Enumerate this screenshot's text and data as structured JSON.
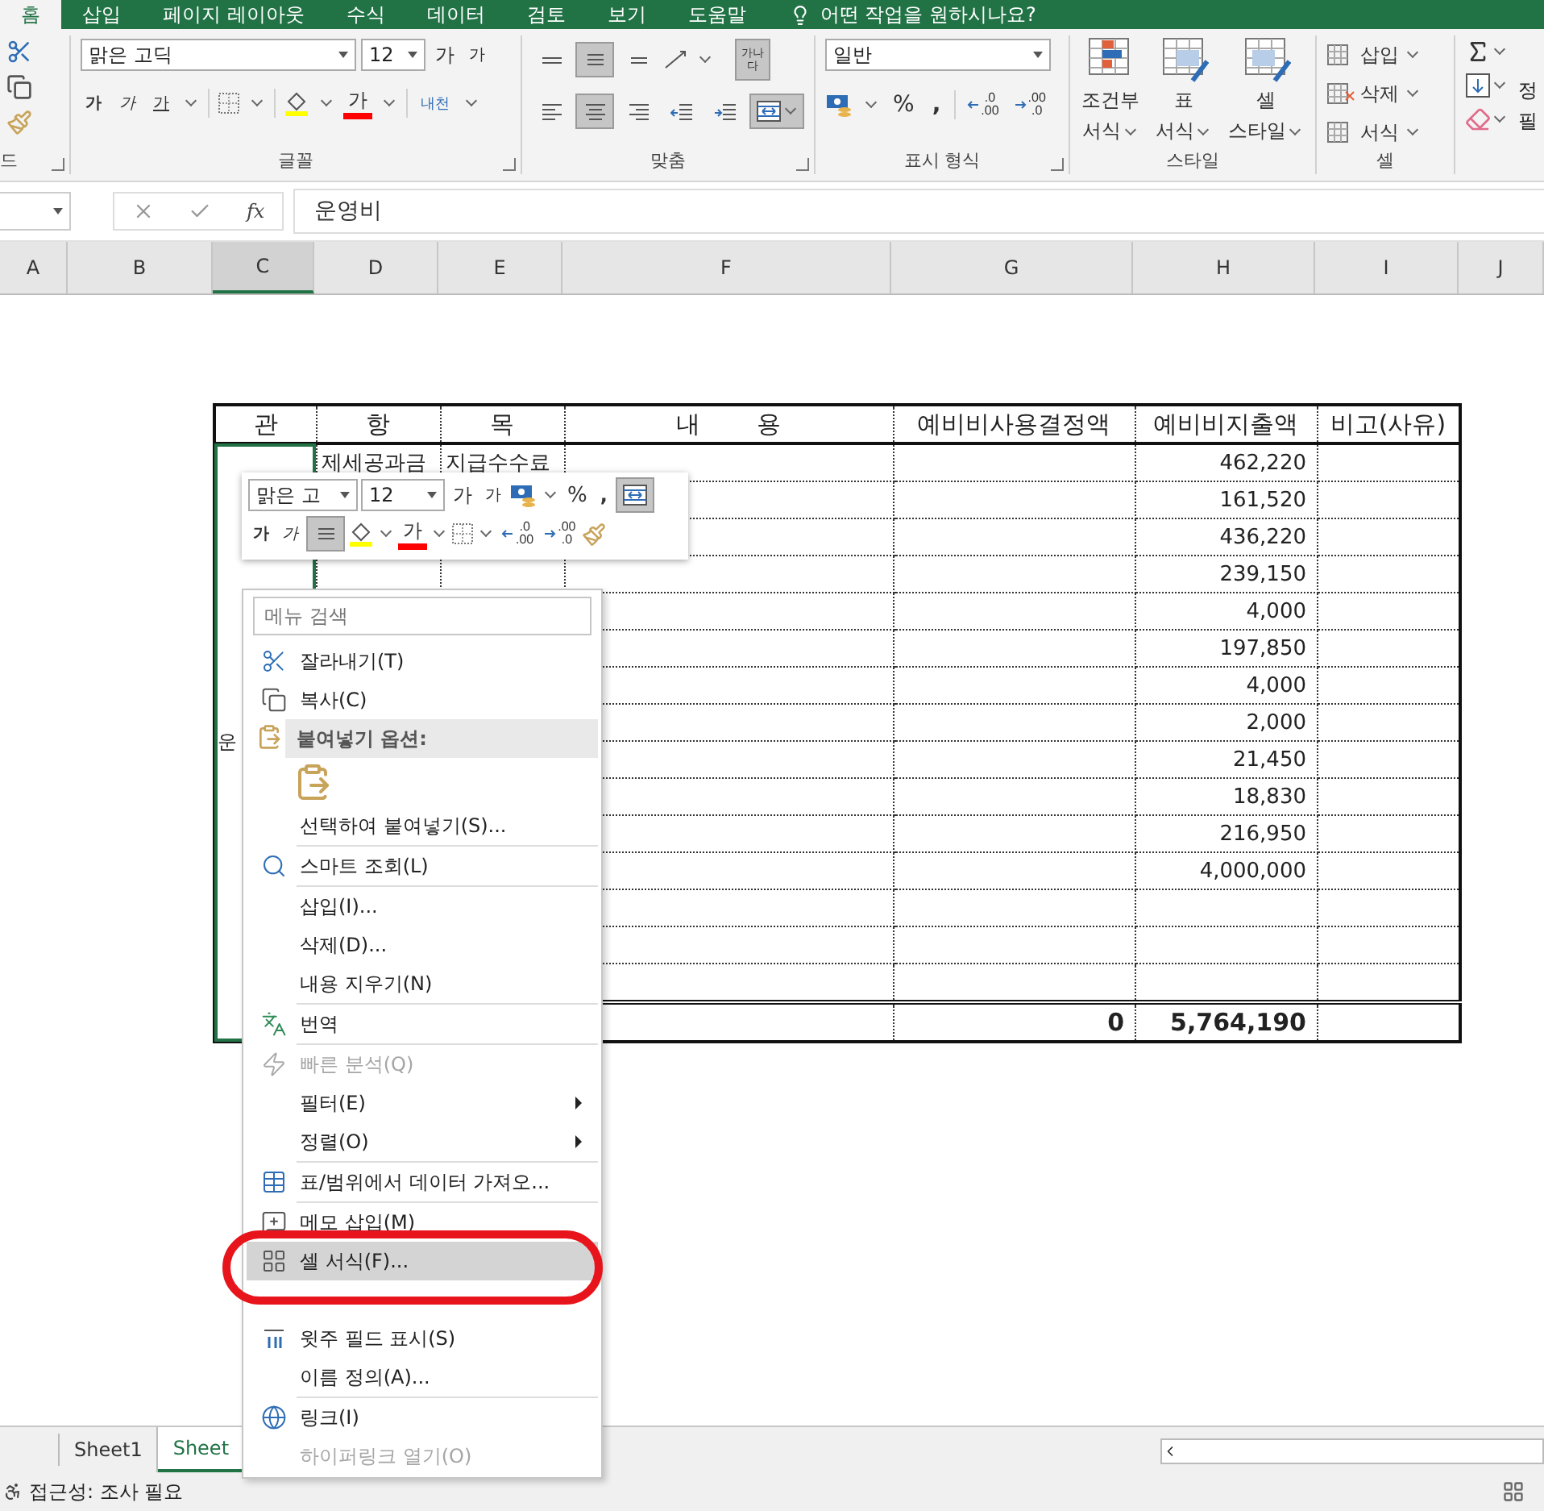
{
  "tabs": [
    {
      "label": "홈",
      "selected": true
    },
    {
      "label": "삽입",
      "selected": false
    },
    {
      "label": "페이지 레이아웃",
      "selected": false
    },
    {
      "label": "수식",
      "selected": false
    },
    {
      "label": "데이터",
      "selected": false
    },
    {
      "label": "검토",
      "selected": false
    },
    {
      "label": "보기",
      "selected": false
    },
    {
      "label": "도움말",
      "selected": false
    }
  ],
  "tell_me": "어떤 작업을 원하시나요?",
  "ribbon": {
    "clipboard_label": "드",
    "font": {
      "name": "맑은 고딕",
      "size": "12",
      "grow": "가",
      "shrink": "가",
      "bold": "가",
      "italic": "가",
      "underline": "가",
      "color_glyph": "가",
      "phonetic": "내천",
      "label": "글꼴"
    },
    "alignment": {
      "top_row": [
        {
          "kind": "top",
          "selected": false
        },
        {
          "kind": "middle",
          "selected": true
        },
        {
          "kind": "bottom",
          "selected": false
        }
      ],
      "bottom_row": [
        {
          "kind": "left",
          "selected": false
        },
        {
          "kind": "center",
          "selected": true
        },
        {
          "kind": "right",
          "selected": false
        },
        {
          "kind": "outdent",
          "selected": false
        },
        {
          "kind": "indent",
          "selected": false
        }
      ],
      "wrap": {
        "glyph": "가나다",
        "selected": true
      },
      "merge_selected": true,
      "label": "맞춤"
    },
    "number": {
      "format": "일반",
      "percent": "%",
      "comma": ",",
      "decimals": [
        {
          "top": ".0",
          "bottom": ".00"
        },
        {
          "top": ".00",
          "bottom": ".0"
        }
      ],
      "label": "표시 형식"
    },
    "styles": {
      "buttons": [
        {
          "line1": "조건부",
          "line2": "서식"
        },
        {
          "line1": "표",
          "line2": "서식"
        },
        {
          "line1": "셀",
          "line2": "스타일"
        }
      ],
      "label": "스타일"
    },
    "cells": {
      "buttons": [
        "삽입",
        "삭제",
        "서식"
      ],
      "label": "셀"
    },
    "editing": {
      "parts": [
        "정",
        "필"
      ]
    }
  },
  "formula_bar": {
    "function_label": "fx",
    "value": "운영비"
  },
  "columns": [
    {
      "letter": "A",
      "selected": false
    },
    {
      "letter": "B",
      "selected": false
    },
    {
      "letter": "C",
      "selected": true
    },
    {
      "letter": "D",
      "selected": false
    },
    {
      "letter": "E",
      "selected": false
    },
    {
      "letter": "F",
      "selected": false
    },
    {
      "letter": "G",
      "selected": false
    },
    {
      "letter": "H",
      "selected": false
    },
    {
      "letter": "I",
      "selected": false
    },
    {
      "letter": "J",
      "selected": false
    }
  ],
  "table": {
    "headers": [
      "관",
      "항",
      "목",
      "내 용",
      "예비비사용결정액",
      "예비비지출액",
      "비고(사유)"
    ],
    "group": {
      "label": "운",
      "selected": true
    },
    "rows": [
      {
        "item": "제세공과금",
        "subitem": "지급수수료",
        "spent": "462,220"
      },
      {
        "spent": "161,520"
      },
      {
        "spent": "436,220"
      },
      {
        "spent": "239,150"
      },
      {
        "spent": "4,000"
      },
      {
        "spent": "197,850"
      },
      {
        "spent": "4,000"
      },
      {
        "spent": "2,000"
      },
      {
        "spent": "21,450"
      },
      {
        "spent": "18,830"
      },
      {
        "spent": "216,950"
      },
      {
        "spent": "4,000,000"
      },
      {},
      {},
      {}
    ],
    "total": {
      "decided": "0",
      "spent": "5,764,190"
    }
  },
  "mini_toolbar": {
    "font": "맑은 고",
    "size": "12",
    "grow": "가",
    "shrink": "가",
    "percent": "%",
    "comma": ",",
    "merge_selected": true,
    "bold": "가",
    "italic": "가",
    "center_selected": true,
    "color_glyph": "가",
    "decimals": [
      {
        "top": ".0",
        "bottom": ".00"
      },
      {
        "top": ".00",
        "bottom": ".0"
      }
    ]
  },
  "context_menu": {
    "search_placeholder": "메뉴 검색",
    "items": [
      {
        "kind": "item",
        "label": "잘라내기(T)",
        "disabled": false,
        "selected": false
      },
      {
        "kind": "item",
        "label": "복사(C)",
        "disabled": false,
        "selected": false
      },
      {
        "kind": "header",
        "label": "붙여넣기 옵션:"
      },
      {
        "kind": "paste-icons"
      },
      {
        "kind": "item",
        "label": "선택하여 붙여넣기(S)...",
        "disabled": false,
        "selected": false
      },
      {
        "kind": "separator"
      },
      {
        "kind": "item",
        "label": "스마트 조회(L)",
        "disabled": false,
        "selected": false
      },
      {
        "kind": "separator"
      },
      {
        "kind": "item",
        "label": "삽입(I)...",
        "disabled": false,
        "selected": false
      },
      {
        "kind": "item",
        "label": "삭제(D)...",
        "disabled": false,
        "selected": false
      },
      {
        "kind": "item",
        "label": "내용 지우기(N)",
        "disabled": false,
        "selected": false
      },
      {
        "kind": "separator"
      },
      {
        "kind": "item",
        "label": "번역",
        "disabled": false,
        "selected": false
      },
      {
        "kind": "separator"
      },
      {
        "kind": "item",
        "label": "빠른 분석(Q)",
        "disabled": true,
        "selected": false
      },
      {
        "kind": "submenu",
        "label": "필터(E)",
        "disabled": false,
        "selected": false
      },
      {
        "kind": "submenu",
        "label": "정렬(O)",
        "disabled": false,
        "selected": false
      },
      {
        "kind": "separator"
      },
      {
        "kind": "item",
        "label": "표/범위에서 데이터 가져오...",
        "disabled": false,
        "selected": false
      },
      {
        "kind": "separator"
      },
      {
        "kind": "item",
        "label": "메모 삽입(M)",
        "disabled": false,
        "selected": false
      },
      {
        "kind": "item",
        "label": "셀 서식(F)...",
        "disabled": false,
        "selected": true
      },
      {
        "kind": "covered"
      },
      {
        "kind": "item",
        "label": "윗주 필드 표시(S)",
        "disabled": false,
        "selected": false
      },
      {
        "kind": "item",
        "label": "이름 정의(A)...",
        "disabled": false,
        "selected": false
      },
      {
        "kind": "separator"
      },
      {
        "kind": "item",
        "label": "링크(I)",
        "disabled": false,
        "selected": false
      },
      {
        "kind": "item",
        "label": "하이퍼링크 열기(O)",
        "disabled": true,
        "selected": false
      }
    ]
  },
  "sheets": [
    {
      "label": "Sheet1",
      "selected": false
    },
    {
      "label": "Sheet",
      "selected": true
    }
  ],
  "status": {
    "text": "접근성: 조사 필요"
  }
}
